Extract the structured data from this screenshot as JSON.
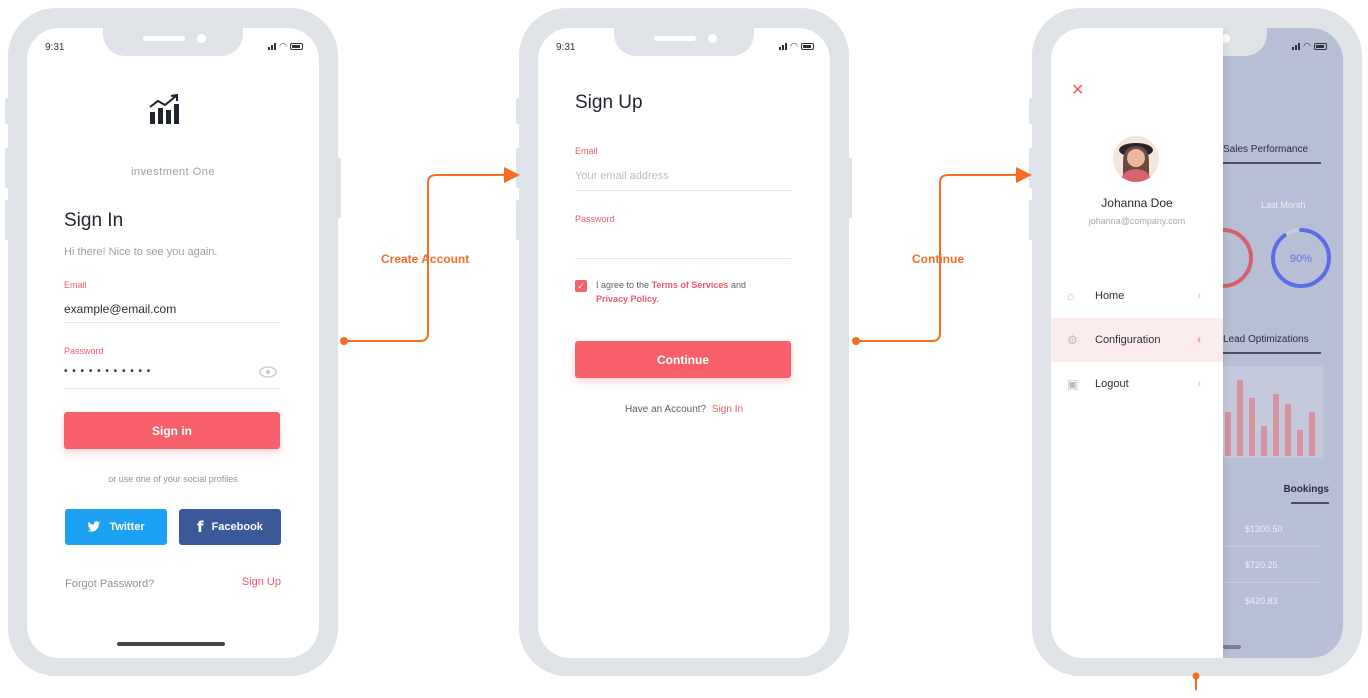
{
  "status": {
    "time": "9:31"
  },
  "signin": {
    "brand": "investment One",
    "title": "Sign In",
    "subtitle": "Hi there! Nice to see you again.",
    "email_label": "Email",
    "email_value": "example@email.com",
    "password_label": "Password",
    "password_value": "• • • • • • • • • • •",
    "button": "Sign in",
    "social_text": "or use one of your social profiles",
    "twitter": "Twitter",
    "facebook": "Facebook",
    "forgot": "Forgot Password?",
    "signup": "Sign Up"
  },
  "connectors": {
    "create_account": "Create Account",
    "continue": "Continue"
  },
  "signup": {
    "title": "Sign Up",
    "email_label": "Email",
    "email_placeholder": "Your email address",
    "password_label": "Password",
    "agree_prefix": "I agree to the",
    "terms": "Terms of Services",
    "and": "and",
    "privacy": "Privacy Policy.",
    "button": "Continue",
    "have_account": "Have an Account?",
    "signin_link": "Sign In"
  },
  "drawer": {
    "close": "✕",
    "name": "Johanna Doe",
    "email": "johanna@company.com",
    "items": [
      {
        "label": "Home",
        "icon": "home-icon",
        "glyph": "⌂",
        "chev": "›"
      },
      {
        "label": "Configuration",
        "icon": "gear-icon",
        "glyph": "⚙",
        "chev": "‹"
      },
      {
        "label": "Logout",
        "icon": "user-icon",
        "glyph": "▣",
        "chev": "›"
      }
    ]
  },
  "dashboard": {
    "sales_title": "Sales Performance",
    "last_month": "Last Month",
    "gauge_value": "90%",
    "gauge_fraction": 0.9,
    "lead_title": "Lead Optimizations",
    "bookings": "Bookings",
    "amounts": [
      "$1300.50",
      "$720.25",
      "$420.83"
    ]
  },
  "colors": {
    "accent": "#f7606b",
    "connector": "#f36d25",
    "twitter": "#1da1f2",
    "facebook": "#3b5998",
    "gauge": "#5b6ee8"
  }
}
